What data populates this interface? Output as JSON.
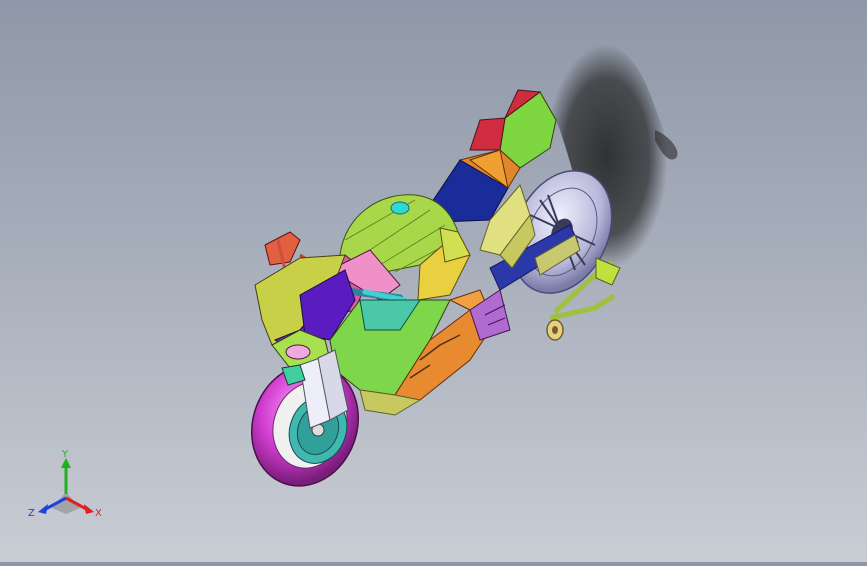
{
  "viewport": {
    "model": "motorcycle-assembly",
    "colors": {
      "background_top": "#8f98a8",
      "background_bottom": "#c9cdd4",
      "shadow": "#2a2a2a"
    }
  },
  "triad": {
    "x_label": "X",
    "y_label": "Y",
    "z_label": "Z",
    "colors": {
      "x": "#e02020",
      "y": "#20b020",
      "z": "#2040e0"
    }
  }
}
